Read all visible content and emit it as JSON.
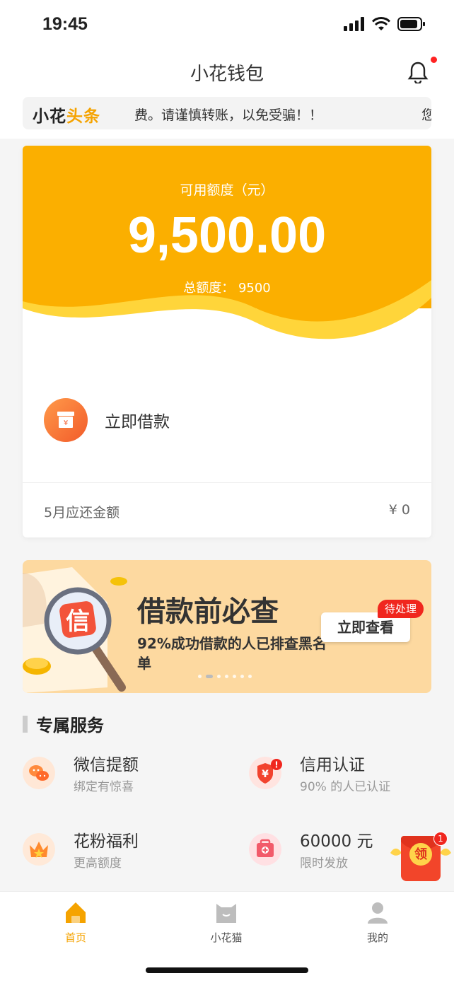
{
  "status_bar": {
    "time": "19:45"
  },
  "header": {
    "title": "小花钱包"
  },
  "ticker": {
    "logo_part1": "小花",
    "logo_part2": "头条",
    "text": "费。请谨慎转账，以免受骗！！",
    "tail": "您"
  },
  "credit_card": {
    "available_label": "可用额度（元）",
    "available_amount": "9,500.00",
    "total_label": "总额度：",
    "total_value": "9500",
    "borrow_label": "立即借款",
    "borrow_icon_symbol": "¥",
    "due_label": "5月应还金额",
    "due_value": "¥ 0"
  },
  "banner": {
    "title": "借款前必查",
    "subtitle": "92%成功借款的人已排查黑名单",
    "button_label": "立即查看",
    "badge": "待处理",
    "seal_char": "信",
    "dot_count": 7,
    "active_dot": 1
  },
  "services": {
    "section_title": "专属服务",
    "items": [
      {
        "title": "微信提额",
        "subtitle": "绑定有惊喜",
        "icon": "wechat-icon"
      },
      {
        "title": "信用认证",
        "subtitle": "90% 的人已认证",
        "icon": "shield-yen-icon",
        "alert": "!"
      },
      {
        "title": "花粉福利",
        "subtitle": "更高额度",
        "icon": "crown-icon"
      },
      {
        "title": "60000 元",
        "subtitle": "限时发放",
        "icon": "money-box-icon"
      }
    ]
  },
  "floating_packet": {
    "label": "领",
    "badge": "1"
  },
  "tabbar": {
    "tabs": [
      {
        "label": "首页",
        "icon": "home-icon",
        "active": true
      },
      {
        "label": "小花猫",
        "icon": "cat-icon",
        "active": false
      },
      {
        "label": "我的",
        "icon": "user-icon",
        "active": false
      }
    ]
  },
  "colors": {
    "accent": "#f5a300",
    "card_gradient_top": "#ffb700",
    "alert": "#f0261e"
  }
}
